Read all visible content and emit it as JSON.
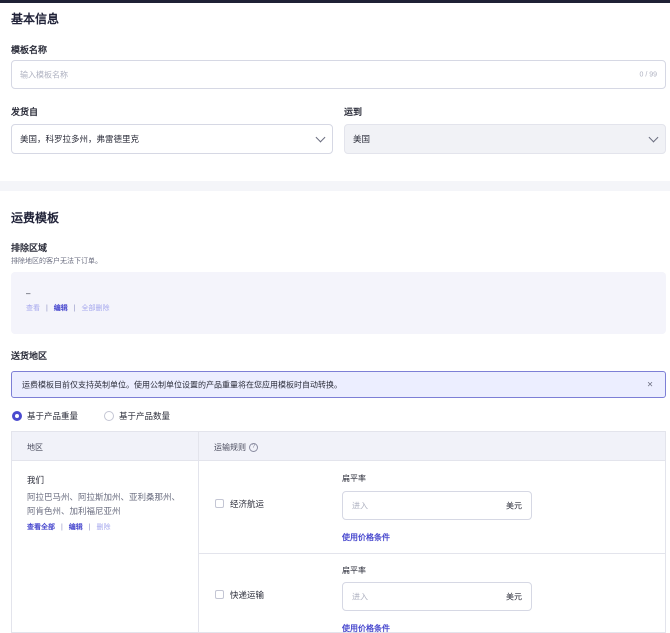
{
  "basic": {
    "section_title": "基本信息",
    "template_name_label": "模板名称",
    "template_name_placeholder": "输入模板名称",
    "template_name_count": "0 / 99",
    "ship_from_label": "发货自",
    "ship_from_value": "美国，科罗拉多州，弗雷德里克",
    "ship_to_label": "运到",
    "ship_to_value": "美国"
  },
  "shipping": {
    "section_title": "运费模板",
    "excluded_label": "排除区域",
    "excluded_hint": "排除地区的客户无法下订单。",
    "excluded_value": "–",
    "excluded_links": {
      "view": "查看",
      "edit": "编辑",
      "remove_all": "全部删除",
      "separator": "|"
    },
    "delivery_label": "送货地区",
    "banner_text": "运费模板目前仅支持英制单位。使用公制单位设置的产品重量将在您应用模板时自动转换。",
    "banner_close": "×",
    "radio_by_weight": "基于产品重量",
    "radio_by_quantity": "基于产品数量",
    "table": {
      "col_region": "地区",
      "col_rules": "运输规则",
      "help_icon": "?",
      "region_name": "我们",
      "region_states": "阿拉巴马州、阿拉斯加州、亚利桑那州、阿肯色州、加利福尼亚州",
      "region_links": {
        "view_all": "查看全部",
        "edit": "编辑",
        "delete": "删除",
        "separator": "|"
      },
      "rules": [
        {
          "method": "经济航运",
          "rate_label": "扁平率",
          "placeholder": "进入",
          "unit": "美元",
          "price_condition": "使用价格条件"
        },
        {
          "method": "快递运输",
          "rate_label": "扁平率",
          "placeholder": "进入",
          "unit": "美元",
          "price_condition": "使用价格条件"
        }
      ]
    }
  },
  "colors": {
    "accent": "#4b4bcf",
    "banner_bg": "#eceeff",
    "banner_border": "#7d7fd6",
    "header_bar": "#1f2135"
  }
}
